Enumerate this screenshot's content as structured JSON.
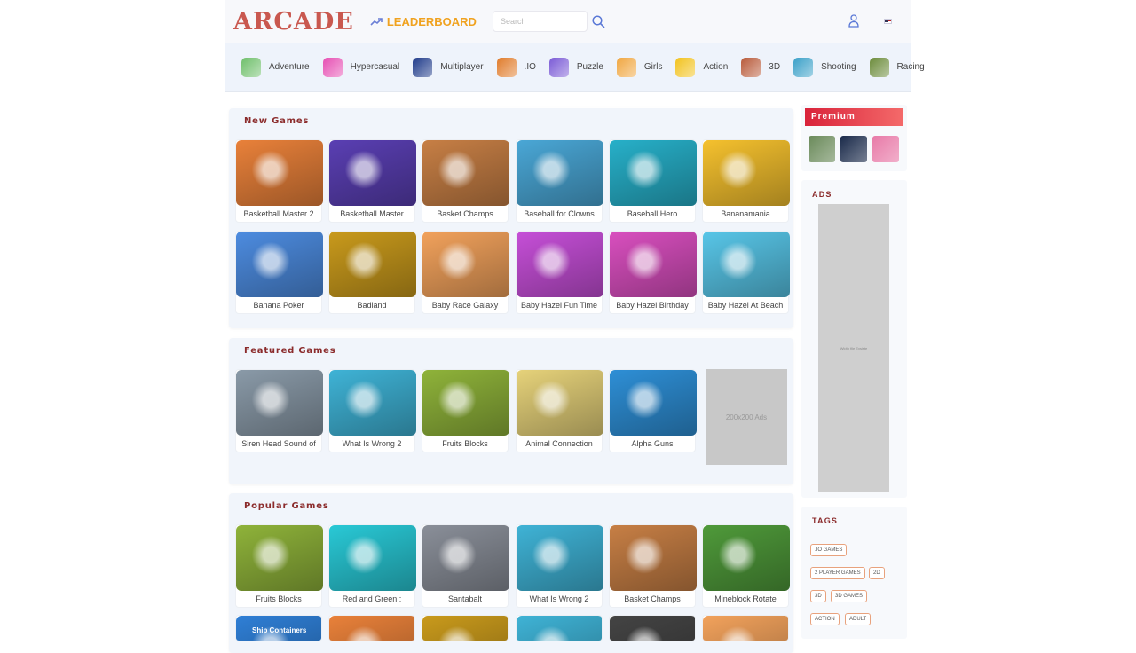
{
  "header": {
    "logo": "ARCADE",
    "leaderboard": "LEADERBOARD",
    "search_placeholder": "Search"
  },
  "categories": [
    {
      "label": "Adventure",
      "icon": "adventure-icon",
      "color": "#6fbf6b"
    },
    {
      "label": "Hypercasual",
      "icon": "hypercasual-icon",
      "color": "#e64fb3"
    },
    {
      "label": "Multiplayer",
      "icon": "multiplayer-icon",
      "color": "#1e3a8a"
    },
    {
      "label": ".IO",
      "icon": "io-icon",
      "color": "#e07b2a"
    },
    {
      "label": "Puzzle",
      "icon": "puzzle-icon",
      "color": "#7b5bd6"
    },
    {
      "label": "Girls",
      "icon": "girls-icon",
      "color": "#f0a640"
    },
    {
      "label": "Action",
      "icon": "action-icon",
      "color": "#f2c21d"
    },
    {
      "label": "3D",
      "icon": "3d-icon",
      "color": "#b85a3a"
    },
    {
      "label": "Shooting",
      "icon": "shooting-icon",
      "color": "#3aa0c8"
    },
    {
      "label": "Racing",
      "icon": "racing-icon",
      "color": "#6b8b3a"
    }
  ],
  "new_games": {
    "title": "New Games",
    "items": [
      {
        "name": "Basketball Master 2",
        "color": "#e9813a"
      },
      {
        "name": "Basketball Master",
        "color": "#5a3fb3"
      },
      {
        "name": "Basket Champs",
        "color": "#c77f45"
      },
      {
        "name": "Baseball for Clowns",
        "color": "#4aa7d6"
      },
      {
        "name": "Baseball Hero",
        "color": "#27b0c9"
      },
      {
        "name": "Bananamania",
        "color": "#f5c12e"
      },
      {
        "name": "Banana Poker",
        "color": "#4d8ce0"
      },
      {
        "name": "Badland",
        "color": "#c99a1c"
      },
      {
        "name": "Baby Race Galaxy",
        "color": "#f2a25c"
      },
      {
        "name": "Baby Hazel Fun Time",
        "color": "#c64fd8"
      },
      {
        "name": "Baby Hazel Birthday",
        "color": "#d94fbf"
      },
      {
        "name": "Baby Hazel At Beach",
        "color": "#58c6e8"
      }
    ]
  },
  "featured_games": {
    "title": "Featured Games",
    "items": [
      {
        "name": "Siren Head Sound of",
        "color": "#8a9aa8"
      },
      {
        "name": "What Is Wrong 2",
        "color": "#3fb3d6"
      },
      {
        "name": "Fruits Blocks",
        "color": "#8fb33a"
      },
      {
        "name": "Animal Connection",
        "color": "#e6d27a"
      },
      {
        "name": "Alpha Guns",
        "color": "#2e8fd6"
      }
    ],
    "ad_label": "200x200 Ads"
  },
  "popular_games": {
    "title": "Popular Games",
    "items": [
      {
        "name": "Fruits Blocks",
        "color": "#8fb33a"
      },
      {
        "name": "Red and Green :",
        "color": "#29c9d6"
      },
      {
        "name": "Santabalt",
        "color": "#8a8f99"
      },
      {
        "name": "What Is Wrong 2",
        "color": "#3fb3d6"
      },
      {
        "name": "Basket Champs",
        "color": "#c77f45"
      },
      {
        "name": "Mineblock Rotate",
        "color": "#4f9a3a"
      }
    ],
    "partial_items": [
      {
        "name": "Ship Containers",
        "color": "#2f7fd6"
      },
      {
        "name": "",
        "color": "#e9813a"
      },
      {
        "name": "",
        "color": "#c99a1c"
      },
      {
        "name": "",
        "color": "#3fb3d6"
      },
      {
        "name": "",
        "color": "#444444"
      },
      {
        "name": "",
        "color": "#f2a25c"
      },
      {
        "name": "",
        "color": "#9cc7e8"
      }
    ]
  },
  "sidebar": {
    "premium_title": "Premium",
    "premium_items": [
      {
        "name": "tank-game",
        "color": "#6a8a5a"
      },
      {
        "name": "space-game",
        "color": "#1a2a4a"
      },
      {
        "name": "donut-game",
        "color": "#e87aa8"
      }
    ],
    "ads_title": "ADS",
    "ads_text": "Width file Exsiste",
    "tags_title": "TAGS",
    "tags": [
      ".IO GAMES",
      "2 PLAYER GAMES",
      "2D",
      "3D",
      "3D GAMES",
      "ACTION",
      "ADULT"
    ]
  }
}
